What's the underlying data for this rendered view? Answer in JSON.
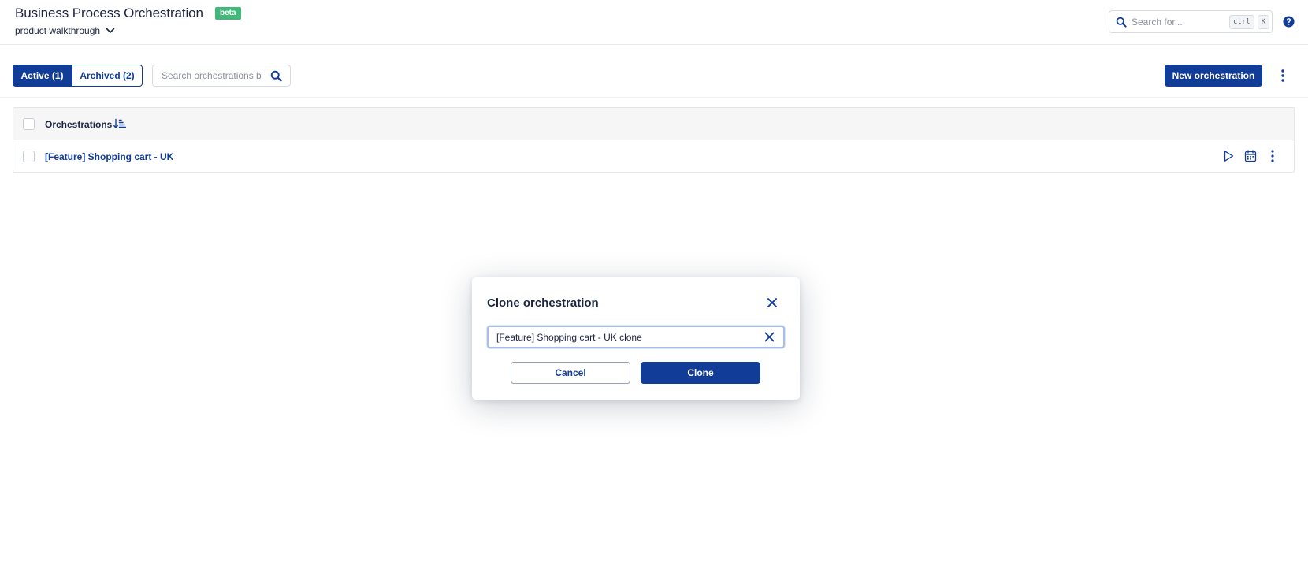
{
  "header": {
    "title": "Business Process Orchestration",
    "badge": "beta",
    "project": "product walkthrough",
    "search_placeholder": "Search for...",
    "shortcut_keys": [
      "ctrl",
      "K"
    ]
  },
  "toolbar": {
    "tabs": [
      {
        "label": "Active (1)",
        "selected": true
      },
      {
        "label": "Archived (2)",
        "selected": false
      }
    ],
    "search_placeholder": "Search orchestrations by name",
    "new_button_label": "New orchestration"
  },
  "table": {
    "header_label": "Orchestrations",
    "rows": [
      {
        "name": "[Feature] Shopping cart - UK"
      }
    ]
  },
  "modal": {
    "title": "Clone orchestration",
    "input_value": "[Feature] Shopping cart - UK clone",
    "cancel_label": "Cancel",
    "confirm_label": "Clone"
  },
  "colors": {
    "primary": "#113c97",
    "badge": "#3fb87a",
    "text": "#1b2540"
  },
  "icons": {
    "header": [
      "chevron-down-icon",
      "search-icon",
      "help-icon"
    ],
    "toolbar": [
      "search-icon",
      "kebab-menu-icon"
    ],
    "table": [
      "sort-icon",
      "play-icon",
      "calendar-icon",
      "kebab-menu-icon"
    ],
    "modal": [
      "close-icon",
      "clear-icon"
    ]
  }
}
